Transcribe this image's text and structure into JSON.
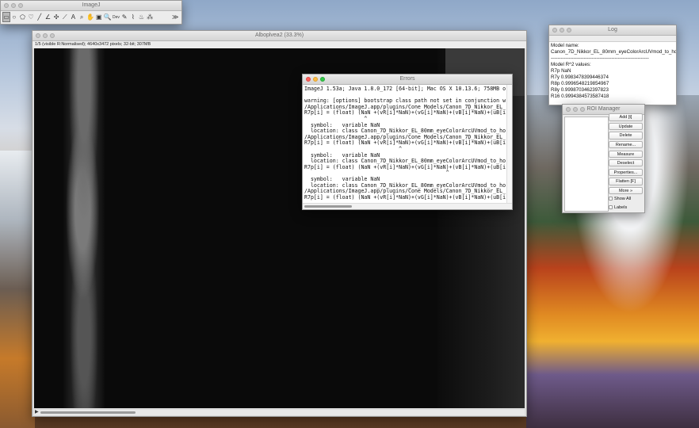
{
  "toolbar": {
    "title": "ImageJ",
    "tools": [
      {
        "name": "rectangle-tool",
        "glyph": "▭"
      },
      {
        "name": "oval-tool",
        "glyph": "○"
      },
      {
        "name": "polygon-tool",
        "glyph": "⬠"
      },
      {
        "name": "freehand-tool",
        "glyph": "♡"
      },
      {
        "name": "line-tool",
        "glyph": "╱"
      },
      {
        "name": "angle-tool",
        "glyph": "∠"
      },
      {
        "name": "point-tool",
        "glyph": "✣"
      },
      {
        "name": "wand-tool",
        "glyph": "⟋"
      },
      {
        "name": "text-tool",
        "glyph": "A"
      },
      {
        "name": "magnifier-tool",
        "glyph": "⌕"
      },
      {
        "name": "hand-tool",
        "glyph": "✋"
      },
      {
        "name": "dropper-tool",
        "glyph": "▣"
      },
      {
        "name": "zoom-tool",
        "glyph": "🔍"
      },
      {
        "name": "dev-tool",
        "glyph": "Dev"
      },
      {
        "name": "pencil-tool",
        "glyph": "✎"
      },
      {
        "name": "brush-tool",
        "glyph": "⌇"
      },
      {
        "name": "flood-tool",
        "glyph": "♨"
      },
      {
        "name": "spray-tool",
        "glyph": "⁂"
      },
      {
        "name": "blank-tool",
        "glyph": ""
      },
      {
        "name": "blank-tool-2",
        "glyph": ""
      },
      {
        "name": "more-tools",
        "glyph": "≫"
      }
    ]
  },
  "image_window": {
    "title": "Alboplvea2 (33.3%)",
    "info": "1/5 (visible R:Normalised); 4640x3472 pixels; 32-bit; 307MB"
  },
  "errors_window": {
    "title": "Errors",
    "text": "ImageJ 1.53a; Java 1.8.0_172 [64-bit]; Mac OS X 10.13.6; 758MB o\n\nwarning: [options] bootstrap class path not set in conjunction w\n/Applications/ImageJ.app/plugins/Cone Models/Canon_7D_Nikkor_EL_\nR7p[i] = (float) (NaN +(vR[i]*NaN)+(vG[i]*NaN)+(vB[i]*NaN)+(uB[i\n                   ^\n  symbol:   variable NaN\n  location: class Canon_7D_Nikkor_EL_80mm_eyeColorArcUVmod_to_ho\n/Applications/ImageJ.app/plugins/Cone Models/Canon_7D_Nikkor_EL_\nR7p[i] = (float) (NaN +(vR[i]*NaN)+(vG[i]*NaN)+(vB[i]*NaN)+(uB[i\n                              ^\n  symbol:   variable NaN\n  location: class Canon_7D_Nikkor_EL_80mm_eyeColorArcUVmod_to_ho\nR7p[i] = (float) (NaN +(vR[i]*NaN)+(vG[i]*NaN)+(vB[i]*NaN)+(uB[i\n                                             ^\n  symbol:   variable NaN\n  location: class Canon_7D_Nikkor_EL_80mm_eyeColorArcUVmod_to_ho\n/Applications/ImageJ.app/plugins/Cone Models/Canon_7D_Nikkor_EL_\nR7p[i] = (float) (NaN +(vR[i]*NaN)+(vG[i]*NaN)+(vB[i]*NaN)+(uB[i"
  },
  "log_window": {
    "title": "Log",
    "text": "Model name:\nCanon_7D_Nikkor_EL_80mm_eyeColorArcUVmod_to_ho\n------------------------------------------------------------\nModel R^2 values:\nR7p NaN\nR7y 0.9983478399446374\nR8p 0.9996548219854967\nR8y 0.9998703462397823\nR16 0.9994384573587418"
  },
  "roi_manager": {
    "title": "ROI Manager",
    "buttons": [
      "Add [t]",
      "Update",
      "Delete",
      "Rename...",
      "Measure",
      "Deselect",
      "Properties...",
      "Flatten [F]",
      "More »"
    ],
    "show_all_label": "Show All",
    "labels_label": "Labels"
  },
  "colors": {
    "close": "#fc605c",
    "minimize": "#fdbc40",
    "zoom": "#34c84a"
  }
}
